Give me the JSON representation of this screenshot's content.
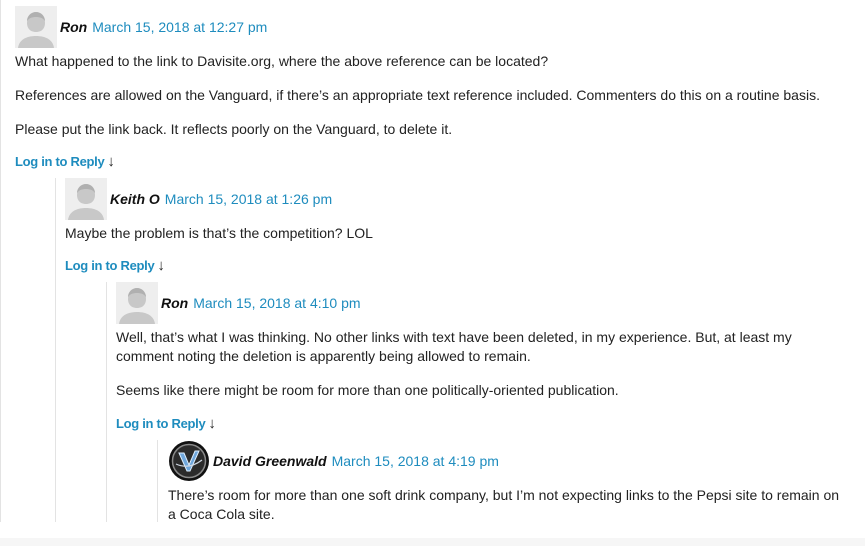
{
  "comments": [
    {
      "author": "Ron",
      "date": "March 15, 2018 at 12:27 pm",
      "avatar": "default-avatar",
      "paragraphs": [
        "What happened to the link to Davisite.org, where the above reference can be located?",
        "References are allowed on the Vanguard, if there’s an appropriate text reference included. Commenters do this on a routine basis.",
        "Please put the link back. It reflects poorly on the Vanguard, to delete it."
      ],
      "reply_label": "Log in to Reply",
      "reply_arrow": "↓"
    },
    {
      "author": "Keith O",
      "date": "March 15, 2018 at 1:26 pm",
      "avatar": "default-avatar",
      "paragraphs": [
        "Maybe the problem is that’s the competition?  LOL"
      ],
      "reply_label": "Log in to Reply",
      "reply_arrow": "↓"
    },
    {
      "author": "Ron",
      "date": "March 15, 2018 at 4:10 pm",
      "avatar": "default-avatar",
      "paragraphs": [
        "Well, that’s what I was thinking.  No other links with text have been deleted, in my experience. But, at least my",
        "comment noting the deletion is apparently being allowed to remain.",
        "Seems like there might be room for more than one politically-oriented publication."
      ],
      "reply_label": "Log in to Reply",
      "reply_arrow": "↓"
    },
    {
      "author": "David Greenwald",
      "date": "March 15, 2018 at 4:19 pm",
      "avatar": "vanguard-logo-avatar",
      "paragraphs": [
        "There’s room for more than one soft drink company, but I’m not expecting links to the Pepsi site to remain on",
        "a Coca Cola site."
      ]
    }
  ],
  "colors": {
    "link": "#1e8cbe",
    "text": "#222222",
    "thread_line": "#e3e3e3"
  }
}
